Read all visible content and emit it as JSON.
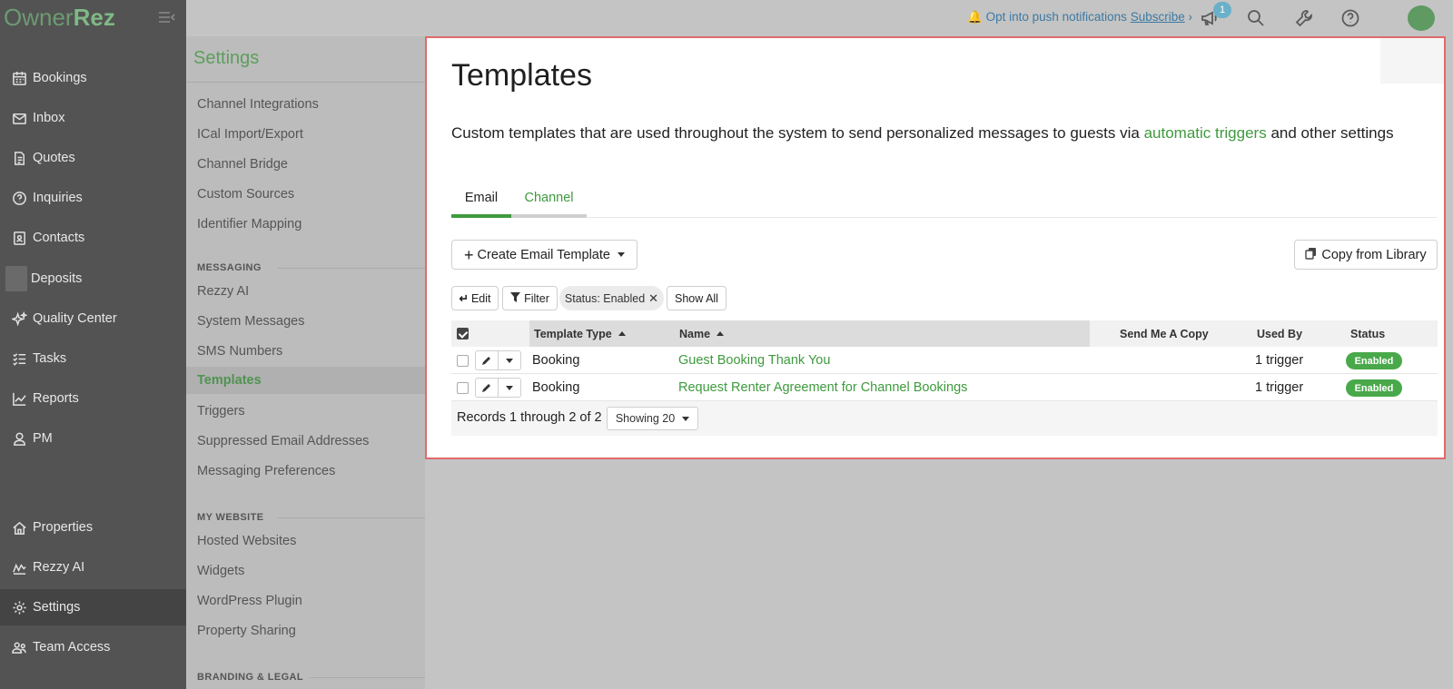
{
  "brand": {
    "part1": "Owner",
    "part2": "Rez"
  },
  "leftnav": {
    "items": [
      {
        "label": "Bookings"
      },
      {
        "label": "Inbox"
      },
      {
        "label": "Quotes"
      },
      {
        "label": "Inquiries"
      },
      {
        "label": "Contacts"
      },
      {
        "label": "Deposits"
      },
      {
        "label": "Quality Center"
      },
      {
        "label": "Tasks"
      },
      {
        "label": "Reports"
      },
      {
        "label": "PM"
      }
    ],
    "bottom_items": [
      {
        "label": "Properties"
      },
      {
        "label": "Rezzy AI"
      },
      {
        "label": "Settings",
        "active": true
      },
      {
        "label": "Team Access"
      }
    ]
  },
  "topbar": {
    "push_text": "Opt into push notifications",
    "subscribe_label": "Subscribe",
    "notification_count": "1"
  },
  "subnav": {
    "title": "Settings",
    "items_top": [
      "Channel Integrations",
      "ICal Import/Export",
      "Channel Bridge",
      "Custom Sources",
      "Identifier Mapping"
    ],
    "messaging_head": "MESSAGING",
    "messaging_items": [
      "Rezzy AI",
      "System Messages",
      "SMS Numbers",
      "Templates",
      "Triggers",
      "Suppressed Email Addresses",
      "Messaging Preferences"
    ],
    "website_head": "MY WEBSITE",
    "website_items": [
      "Hosted Websites",
      "Widgets",
      "WordPress Plugin",
      "Property Sharing"
    ],
    "branding_head": "BRANDING & LEGAL"
  },
  "main": {
    "title": "Templates",
    "desc_pre": "Custom templates that are used throughout the system to send personalized messages to guests via ",
    "desc_link": "automatic triggers",
    "desc_post": " and other settings",
    "tabs": [
      {
        "label": "Email",
        "active": true
      },
      {
        "label": "Channel"
      }
    ],
    "create_label": "Create Email Template",
    "copy_label": "Copy from Library",
    "edit_label": "Edit",
    "filter_label": "Filter",
    "status_chip": "Status: Enabled",
    "show_all_label": "Show All",
    "columns": {
      "type": "Template Type",
      "name": "Name",
      "send_copy": "Send Me A Copy",
      "used_by": "Used By",
      "status": "Status"
    },
    "rows": [
      {
        "type": "Booking",
        "name": "Guest Booking Thank You",
        "used_by": "1 trigger",
        "status": "Enabled"
      },
      {
        "type": "Booking",
        "name": "Request Renter Agreement for Channel Bookings",
        "used_by": "1 trigger",
        "status": "Enabled"
      }
    ],
    "records_text": "Records 1 through 2 of 2",
    "showing_label": "Showing 20"
  },
  "colors": {
    "accent": "#3e9a3e",
    "nav_bg": "#535353",
    "highlight_border": "#e06a6a"
  }
}
